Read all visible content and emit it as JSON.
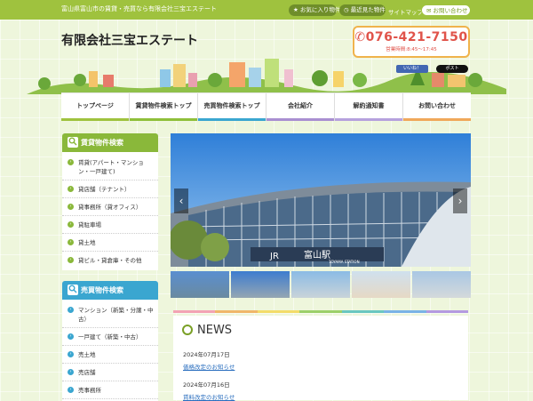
{
  "header": {
    "tagline": "富山県富山市の賃貸・売買なら有限会社三宝エステート",
    "fav_label": "お気に入り物件",
    "recent_label": "最近見た物件",
    "sitemap_label": "サイトマップ",
    "contact_label": "お問い合わせ",
    "company_name": "有限会社三宝エステート",
    "phone": "076-421-7150",
    "hours": "営業時間:8:45～17:45",
    "fb_label": "いいね！",
    "post_label": "ポスト"
  },
  "nav": {
    "items": [
      {
        "label": "トップページ",
        "color": "#9fc23e"
      },
      {
        "label": "賃貸物件検索トップ",
        "color": "#8fbf3a"
      },
      {
        "label": "売買物件検索トップ",
        "color": "#3aa6d0"
      },
      {
        "label": "会社紹介",
        "color": "#a98fd1"
      },
      {
        "label": "解約通知書",
        "color": "#b6a1dd"
      },
      {
        "label": "お問い合わせ",
        "color": "#f0a85a"
      }
    ]
  },
  "sidebar": {
    "rent": {
      "title": "賃貸物件検索",
      "color": "#8ab83a",
      "items": [
        "賃貸(アパート・マンション・一戸建て)",
        "貸店舗（テナント）",
        "貸事務所（貸オフィス）",
        "貸駐車場",
        "貸土地",
        "貸ビル・貸倉庫・その他"
      ]
    },
    "sale": {
      "title": "売買物件検索",
      "color": "#3aa6d0",
      "items": [
        "マンション（新築・分譲・中古）",
        "一戸建て（新築・中古）",
        "売土地",
        "売店舗",
        "売事務所"
      ]
    }
  },
  "hero": {
    "prev_label": "‹",
    "next_label": "›",
    "sign_text": "富山駅",
    "sign_sub": "TOYAMA STATION",
    "jr_text": "JR"
  },
  "rainbow_colors": [
    "#f3a3b4",
    "#f0b76a",
    "#f3dc6a",
    "#9cd06a",
    "#6ac7c0",
    "#7ab3e6",
    "#b49ae0"
  ],
  "news": {
    "title": "NEWS",
    "items": [
      {
        "date": "2024年07月17日",
        "link": "価格改定のお知らせ"
      },
      {
        "date": "2024年07月16日",
        "link": "賃料改定のお知らせ"
      }
    ]
  }
}
